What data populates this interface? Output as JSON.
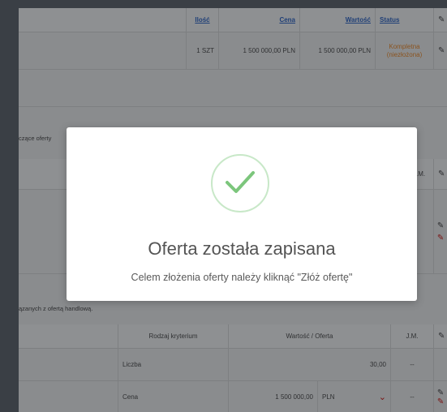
{
  "top_table": {
    "headers": {
      "qty": "Ilość",
      "price": "Cena",
      "value": "Wartość",
      "status": "Status"
    },
    "row": {
      "qty": "1 SZT",
      "price": "1 500 000,00 PLN",
      "value": "1 500 000,00 PLN",
      "status": "Kompletna (niezłożona)"
    }
  },
  "section1_label": "czące oferty",
  "mid_header": {
    "unit": "J.M."
  },
  "section2_label": "ązanych z ofertą handlową.",
  "criteria_table": {
    "headers": {
      "kind": "Rodzaj kryterium",
      "value_offer": "Wartość / Oferta",
      "unit": "J.M."
    },
    "rows": [
      {
        "kind": "Liczba",
        "value": "30,00",
        "currency": "",
        "unit": "--"
      },
      {
        "kind": "Cena",
        "value": "1 500 000,00",
        "currency": "PLN",
        "unit": "--"
      }
    ]
  },
  "modal": {
    "title": "Oferta została zapisana",
    "subtitle": "Celem złożenia oferty należy kliknąć \"Złóż ofertę\"",
    "icon": "check-icon",
    "colors": {
      "check": "#7cc67c",
      "ring": "#c8e8c8"
    }
  },
  "icons": {
    "edit": "pencil-icon",
    "dropdown": "chevron-down-icon"
  }
}
